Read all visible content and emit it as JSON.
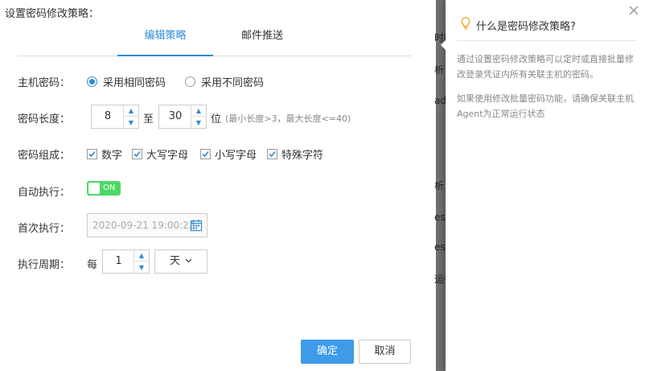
{
  "dialog": {
    "title": "设置密码修改策略：",
    "tabs": [
      {
        "label": "编辑策略",
        "active": true
      },
      {
        "label": "邮件推送",
        "active": false
      }
    ]
  },
  "form": {
    "host_password": {
      "label": "主机密码：",
      "options": [
        {
          "label": "采用相同密码",
          "selected": true
        },
        {
          "label": "采用不同密码",
          "selected": false
        }
      ]
    },
    "password_length": {
      "label": "密码长度：",
      "min": "8",
      "to_text": "至",
      "max": "30",
      "unit": "位",
      "hint": "(最小长度>3，最大长度<=40)"
    },
    "composition": {
      "label": "密码组成：",
      "options": [
        {
          "label": "数字",
          "checked": true
        },
        {
          "label": "大写字母",
          "checked": true
        },
        {
          "label": "小写字母",
          "checked": true
        },
        {
          "label": "特殊字符",
          "checked": true
        }
      ]
    },
    "auto_execute": {
      "label": "自动执行：",
      "toggle_text": "ON",
      "enabled": true
    },
    "first_execute": {
      "label": "首次执行：",
      "value": "2020-09-21 19:00:22"
    },
    "period": {
      "label": "执行周期：",
      "prefix": "每",
      "value": "1",
      "unit": "天"
    }
  },
  "buttons": {
    "confirm": "确定",
    "cancel": "取消"
  },
  "background_fragments": [
    "时能",
    "析",
    "ad",
    "析",
    "es",
    "es",
    "运行"
  ],
  "help": {
    "title": "什么是密码修改策略?",
    "text1": "通过设置密码修改策略可以定时或直接批量修改登录凭证内所有关联主机的密码。",
    "text2": "如果使用修改批量密码功能，请确保关联主机Agent为正常运行状态"
  },
  "colors": {
    "accent": "#2d8cd8",
    "primary_button": "#3d9be9",
    "toggle_on": "#4cd964",
    "bulb": "#f5a623"
  },
  "icons": [
    "radio",
    "spinner-up-arrow",
    "spinner-down-arrow",
    "checkmark",
    "calendar-icon",
    "chevron-down-icon",
    "lightbulb-icon",
    "close-icon"
  ]
}
